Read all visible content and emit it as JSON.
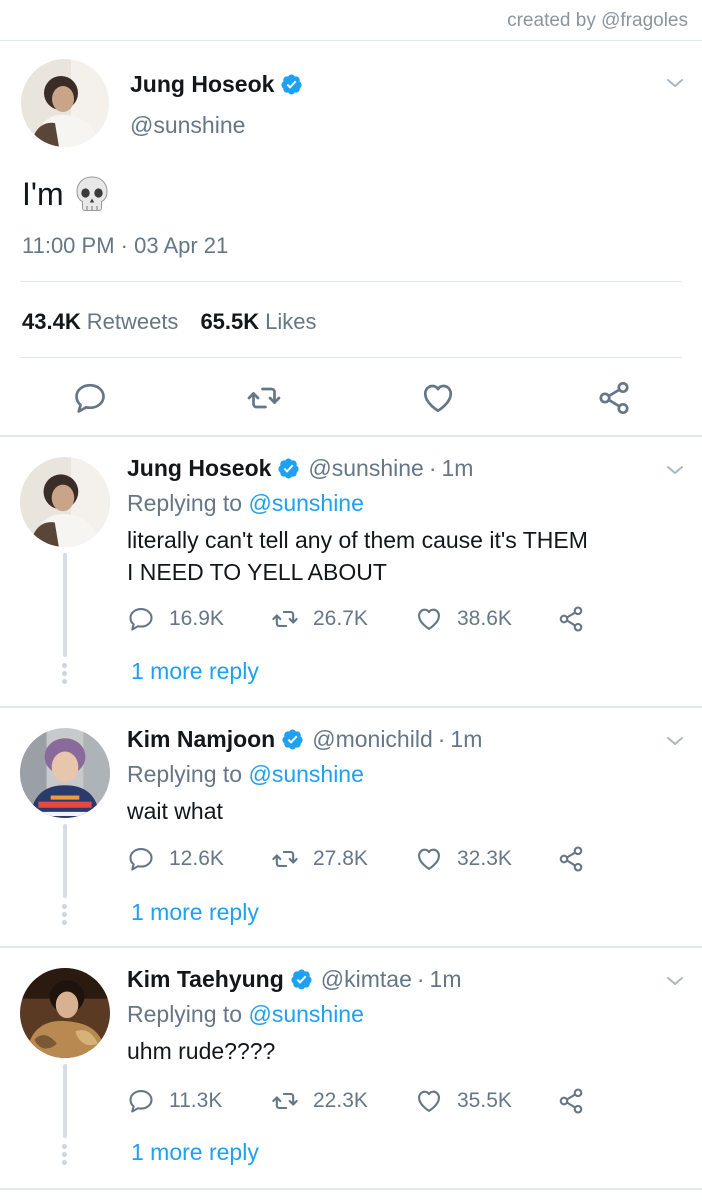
{
  "credit": "created by @fragoles",
  "main_tweet": {
    "name": "Jung Hoseok",
    "handle": "@sunshine",
    "text": "I'm",
    "emoji": "skull-icon",
    "timestamp": "11:00 PM · 03 Apr 21",
    "retweets_count": "43.4K",
    "retweets_label": "Retweets",
    "likes_count": "65.5K",
    "likes_label": "Likes"
  },
  "replies": [
    {
      "name": "Jung Hoseok",
      "handle": "@sunshine",
      "sep": "·",
      "time": "1m",
      "replying_prefix": "Replying to",
      "replying_to": "@sunshine",
      "text_line1": "literally can't tell any of them cause it's THEM",
      "text_line2": "I NEED TO YELL ABOUT",
      "replies_count": "16.9K",
      "retweets_count": "26.7K",
      "likes_count": "38.6K",
      "more_label": "1 more reply"
    },
    {
      "name": "Kim Namjoon",
      "handle": "@monichild",
      "sep": "·",
      "time": "1m",
      "replying_prefix": "Replying to",
      "replying_to": "@sunshine",
      "text_line1": "wait what",
      "replies_count": "12.6K",
      "retweets_count": "27.8K",
      "likes_count": "32.3K",
      "more_label": "1 more reply"
    },
    {
      "name": "Kim Taehyung",
      "handle": "@kimtae",
      "sep": "·",
      "time": "1m",
      "replying_prefix": "Replying to",
      "replying_to": "@sunshine",
      "text_line1": "uhm rude????",
      "replies_count": "11.3K",
      "retweets_count": "22.3K",
      "likes_count": "35.5K",
      "more_label": "1 more reply"
    }
  ],
  "colors": {
    "accent": "#1da1f2",
    "secondary_text": "#657786",
    "divider": "#e1e8ed"
  }
}
